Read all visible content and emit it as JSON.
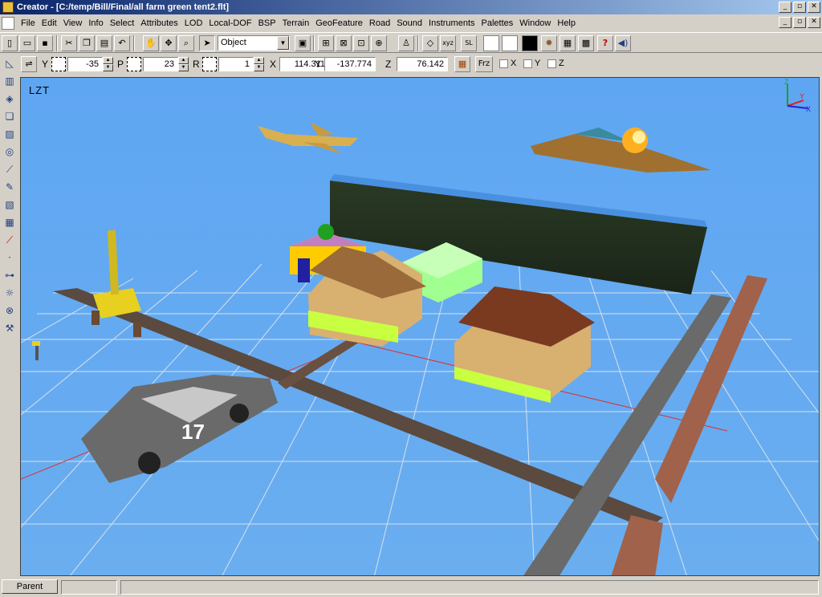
{
  "window": {
    "title": "Creator - [C:/temp/Bill/Final/all farm green tent2.flt]",
    "min_glyph": "_",
    "max_glyph": "▫",
    "close_glyph": "✕"
  },
  "menu": [
    {
      "label": "File"
    },
    {
      "label": "Edit"
    },
    {
      "label": "View"
    },
    {
      "label": "Info"
    },
    {
      "label": "Select"
    },
    {
      "label": "Attributes"
    },
    {
      "label": "LOD"
    },
    {
      "label": "Local-DOF"
    },
    {
      "label": "BSP"
    },
    {
      "label": "Terrain"
    },
    {
      "label": "GeoFeature"
    },
    {
      "label": "Road"
    },
    {
      "label": "Sound"
    },
    {
      "label": "Instruments"
    },
    {
      "label": "Palettes"
    },
    {
      "label": "Window"
    },
    {
      "label": "Help"
    }
  ],
  "toolbar": {
    "select_mode": "Object",
    "swatches": {
      "white1": "#ffffff",
      "white2": "#ffffff",
      "black": "#000000"
    },
    "text_buttons": {
      "xyz": "xyz",
      "sl": "SL"
    }
  },
  "transform_bar": {
    "y_label": "Y",
    "y_value": "-35",
    "p_label": "P",
    "p_value": "23",
    "r_label": "R",
    "r_value": "1",
    "x_label": "X",
    "x_value": "114.311",
    "ycoord_label": "Y",
    "ycoord_value": "-137.774",
    "z_label": "Z",
    "z_value": "76.142",
    "frz_label": "Frz",
    "lock_x": "X",
    "lock_y": "Y",
    "lock_z": "Z"
  },
  "viewport": {
    "label": "LZT",
    "sky_color": "#64aaf0",
    "grid_color": "#d8e0ec",
    "axis": {
      "x": "X",
      "y": "Y",
      "z": "Z"
    },
    "car_number": "17"
  },
  "status": {
    "parent_button": "Parent"
  }
}
